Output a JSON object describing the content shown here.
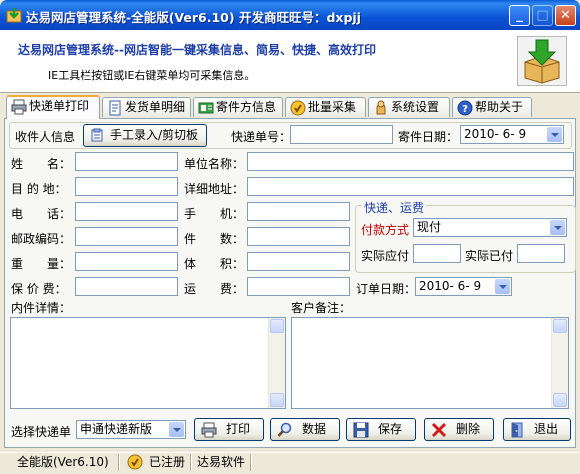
{
  "window": {
    "title": "达易网店管理系统-全能版(Ver6.10) 开发商旺旺号：dxpjj"
  },
  "header": {
    "title": "达易网店管理系统--网店智能一键采集信息、简易、快捷、高效打印",
    "subtitle": "IE工具栏按钮或IE右键菜单均可采集信息。"
  },
  "tabs": [
    {
      "label": "快递单打印",
      "icon": "printer-icon"
    },
    {
      "label": "发货单明细",
      "icon": "document-icon"
    },
    {
      "label": "寄件方信息",
      "icon": "contact-card-icon"
    },
    {
      "label": "批量采集",
      "icon": "collect-icon"
    },
    {
      "label": "系统设置",
      "icon": "settings-icon"
    },
    {
      "label": "帮助关于",
      "icon": "help-icon"
    }
  ],
  "form": {
    "recipient_info_label": "收件人信息",
    "manual_entry_button": "手工录入/剪切板",
    "tracking_no_label": "快递单号：",
    "tracking_no_value": "",
    "ship_date_label": "寄件日期：",
    "ship_date_value": "2010- 6- 9",
    "name_label": "姓　　名：",
    "company_label": "单位名称：",
    "destination_label": "目 的 地：",
    "address_label": "详细地址：",
    "phone_label": "电　　话：",
    "mobile_label": "手　　机：",
    "postcode_label": "邮政编码：",
    "pieces_label": "件　　数：",
    "weight_label": "重　　量：",
    "volume_label": "体　　积：",
    "insured_label": "保 价 费：",
    "freight_label": "运　　费：",
    "order_date_label": "订单日期：",
    "order_date_value": "2010- 6- 9",
    "contents_label": "内件详情：",
    "remarks_label": "客户备注："
  },
  "freight_group": {
    "title": "快递、运费",
    "payment_label": "付款方式",
    "payment_value": "现付",
    "payable_label": "实际应付",
    "paid_label": "实际已付"
  },
  "bottom": {
    "choose_label": "选择快递单",
    "express_value": "申通快递新版",
    "print_button": "打印",
    "data_button": "数据",
    "save_button": "保存",
    "delete_button": "删除",
    "exit_button": "退出"
  },
  "status": {
    "version": "全能版(Ver6.10)",
    "registered": "已注册",
    "company": "达易软件"
  },
  "colors": {
    "accent": "#f5a83b",
    "title_blue": "#0a53d6",
    "header_text": "#1f3fa8",
    "payment_label": "#c00000"
  }
}
